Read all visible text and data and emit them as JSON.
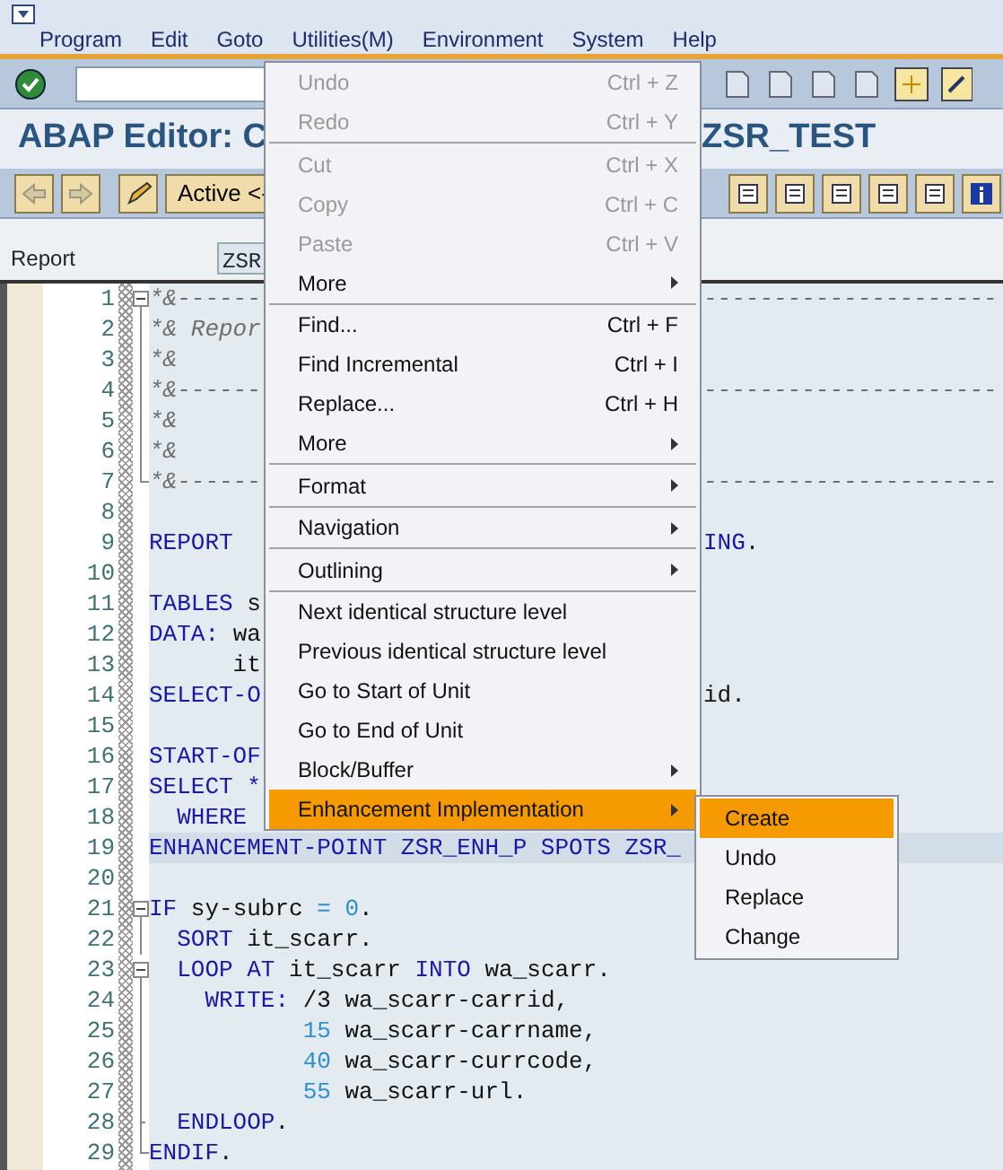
{
  "menubar": {
    "items": [
      {
        "label": "Program"
      },
      {
        "label": "Edit"
      },
      {
        "label": "Goto"
      },
      {
        "label": "Utilities(M)"
      },
      {
        "label": "Environment"
      },
      {
        "label": "System"
      },
      {
        "label": "Help"
      }
    ]
  },
  "title": {
    "left": "ABAP Editor: C",
    "right": "ZSR_TEST"
  },
  "app_toolbar": {
    "mode_button": "Active <-"
  },
  "program_row": {
    "label": "Report",
    "value": "ZSR"
  },
  "editor": {
    "lines": [
      {
        "number": "1",
        "kind": "fold_start",
        "current": false,
        "left": [
          {
            "kind": "comment",
            "text": "*&------"
          }
        ],
        "right": [
          {
            "kind": "comment",
            "text": "---------------------"
          }
        ]
      },
      {
        "number": "2",
        "kind": "fold_inner",
        "current": false,
        "left": [
          {
            "kind": "comment",
            "text": "*& Repor"
          }
        ]
      },
      {
        "number": "3",
        "kind": "fold_inner",
        "current": false,
        "left": [
          {
            "kind": "comment",
            "text": "*&"
          }
        ]
      },
      {
        "number": "4",
        "kind": "fold_inner",
        "current": false,
        "left": [
          {
            "kind": "comment",
            "text": "*&------"
          }
        ],
        "right": [
          {
            "kind": "comment",
            "text": "---------------------"
          }
        ]
      },
      {
        "number": "5",
        "kind": "fold_inner",
        "current": false,
        "left": [
          {
            "kind": "comment",
            "text": "*&"
          }
        ]
      },
      {
        "number": "6",
        "kind": "fold_inner",
        "current": false,
        "left": [
          {
            "kind": "comment",
            "text": "*&"
          }
        ]
      },
      {
        "number": "7",
        "kind": "fold_end",
        "current": false,
        "left": [
          {
            "kind": "comment",
            "text": "*&------"
          }
        ],
        "right": [
          {
            "kind": "comment",
            "text": "---------------------"
          }
        ]
      },
      {
        "number": "8",
        "kind": "plain",
        "current": false
      },
      {
        "number": "9",
        "kind": "plain",
        "current": false,
        "left": [
          {
            "kind": "kw",
            "text": "REPORT"
          }
        ],
        "right": [
          {
            "kind": "kw",
            "text": "ING"
          },
          {
            "kind": "text",
            "text": "."
          }
        ]
      },
      {
        "number": "10",
        "kind": "plain",
        "current": false
      },
      {
        "number": "11",
        "kind": "plain",
        "current": false,
        "left": [
          {
            "kind": "kw",
            "text": "TABLES"
          },
          {
            "kind": "text",
            "text": " s"
          }
        ]
      },
      {
        "number": "12",
        "kind": "plain",
        "current": false,
        "left": [
          {
            "kind": "kw",
            "text": "DATA:"
          },
          {
            "kind": "text",
            "text": " wa"
          }
        ]
      },
      {
        "number": "13",
        "kind": "plain",
        "current": false,
        "left": [
          {
            "kind": "text",
            "text": "      it"
          }
        ]
      },
      {
        "number": "14",
        "kind": "plain",
        "current": false,
        "left": [
          {
            "kind": "kw",
            "text": "SELECT-O"
          }
        ],
        "right": [
          {
            "kind": "text",
            "text": "id."
          }
        ]
      },
      {
        "number": "15",
        "kind": "plain",
        "current": false
      },
      {
        "number": "16",
        "kind": "plain",
        "current": false,
        "left": [
          {
            "kind": "kw",
            "text": "START-OF"
          }
        ]
      },
      {
        "number": "17",
        "kind": "plain",
        "current": false,
        "left": [
          {
            "kind": "kw",
            "text": "SELECT *"
          }
        ]
      },
      {
        "number": "18",
        "kind": "plain",
        "current": false,
        "left": [
          {
            "kind": "kw",
            "text": "  WHERE"
          }
        ]
      },
      {
        "number": "19",
        "kind": "plain",
        "current": true,
        "left": [
          {
            "kind": "kw",
            "text": "ENHANCEMENT-POINT ZSR_ENH_P SPOTS ZSR_"
          }
        ]
      },
      {
        "number": "20",
        "kind": "plain",
        "current": false
      },
      {
        "number": "21",
        "kind": "fold_start",
        "current": false,
        "left": [
          {
            "kind": "kw",
            "text": "IF"
          },
          {
            "kind": "text",
            "text": " sy-subrc "
          },
          {
            "kind": "num",
            "text": "= 0"
          },
          {
            "kind": "text",
            "text": "."
          }
        ]
      },
      {
        "number": "22",
        "kind": "fold_inner",
        "current": false,
        "left": [
          {
            "kind": "kw",
            "text": "  SORT"
          },
          {
            "kind": "text",
            "text": " it_scarr."
          }
        ]
      },
      {
        "number": "23",
        "kind": "fold_start",
        "current": false,
        "left": [
          {
            "kind": "kw",
            "text": "  LOOP AT"
          },
          {
            "kind": "text",
            "text": " it_scarr "
          },
          {
            "kind": "kw",
            "text": "INTO"
          },
          {
            "kind": "text",
            "text": " wa_scarr."
          }
        ]
      },
      {
        "number": "24",
        "kind": "fold_inner",
        "current": false,
        "left": [
          {
            "kind": "kw",
            "text": "    WRITE:"
          },
          {
            "kind": "text",
            "text": " /3 wa_scarr-carrid,"
          }
        ]
      },
      {
        "number": "25",
        "kind": "fold_inner",
        "current": false,
        "left": [
          {
            "kind": "num",
            "text": "           15"
          },
          {
            "kind": "text",
            "text": " wa_scarr-carrname,"
          }
        ]
      },
      {
        "number": "26",
        "kind": "fold_inner",
        "current": false,
        "left": [
          {
            "kind": "num",
            "text": "           40"
          },
          {
            "kind": "text",
            "text": " wa_scarr-currcode,"
          }
        ]
      },
      {
        "number": "27",
        "kind": "fold_inner",
        "current": false,
        "left": [
          {
            "kind": "num",
            "text": "           55"
          },
          {
            "kind": "text",
            "text": " wa_scarr-url."
          }
        ]
      },
      {
        "number": "28",
        "kind": "fold_tick",
        "current": false,
        "left": [
          {
            "kind": "kw",
            "text": "  ENDLOOP"
          },
          {
            "kind": "text",
            "text": "."
          }
        ]
      },
      {
        "number": "29",
        "kind": "fold_end",
        "current": false,
        "left": [
          {
            "kind": "kw",
            "text": "ENDIF"
          },
          {
            "kind": "text",
            "text": "."
          }
        ]
      }
    ]
  },
  "context_menu": {
    "items": [
      {
        "kind": "item",
        "label": "Undo",
        "shortcut": "Ctrl + Z",
        "disabled": true,
        "submenu": false,
        "selected": false
      },
      {
        "kind": "item",
        "label": "Redo",
        "shortcut": "Ctrl + Y",
        "disabled": true,
        "submenu": false,
        "selected": false
      },
      {
        "kind": "separator"
      },
      {
        "kind": "item",
        "label": "Cut",
        "shortcut": "Ctrl + X",
        "disabled": true,
        "submenu": false,
        "selected": false
      },
      {
        "kind": "item",
        "label": "Copy",
        "shortcut": "Ctrl + C",
        "disabled": true,
        "submenu": false,
        "selected": false
      },
      {
        "kind": "item",
        "label": "Paste",
        "shortcut": "Ctrl + V",
        "disabled": true,
        "submenu": false,
        "selected": false
      },
      {
        "kind": "item",
        "label": "More",
        "disabled": false,
        "submenu": true,
        "selected": false
      },
      {
        "kind": "separator"
      },
      {
        "kind": "item",
        "label": "Find...",
        "shortcut": "Ctrl + F",
        "disabled": false,
        "submenu": false,
        "selected": false
      },
      {
        "kind": "item",
        "label": "Find Incremental",
        "shortcut": "Ctrl + I",
        "disabled": false,
        "submenu": false,
        "selected": false
      },
      {
        "kind": "item",
        "label": "Replace...",
        "shortcut": "Ctrl + H",
        "disabled": false,
        "submenu": false,
        "selected": false
      },
      {
        "kind": "item",
        "label": "More",
        "disabled": false,
        "submenu": true,
        "selected": false
      },
      {
        "kind": "separator"
      },
      {
        "kind": "item",
        "label": "Format",
        "disabled": false,
        "submenu": true,
        "selected": false
      },
      {
        "kind": "separator"
      },
      {
        "kind": "item",
        "label": "Navigation",
        "disabled": false,
        "submenu": true,
        "selected": false
      },
      {
        "kind": "separator"
      },
      {
        "kind": "item",
        "label": "Outlining",
        "disabled": false,
        "submenu": true,
        "selected": false
      },
      {
        "kind": "separator"
      },
      {
        "kind": "item",
        "label": "Next identical structure level",
        "disabled": false,
        "submenu": false,
        "selected": false
      },
      {
        "kind": "item",
        "label": "Previous identical structure level",
        "disabled": false,
        "submenu": false,
        "selected": false
      },
      {
        "kind": "item",
        "label": "Go to Start of Unit",
        "disabled": false,
        "submenu": false,
        "selected": false
      },
      {
        "kind": "item",
        "label": "Go to End of Unit",
        "disabled": false,
        "submenu": false,
        "selected": false
      },
      {
        "kind": "item",
        "label": "Block/Buffer",
        "disabled": false,
        "submenu": true,
        "selected": false
      },
      {
        "kind": "item",
        "label": "Enhancement Implementation",
        "disabled": false,
        "submenu": true,
        "selected": true
      }
    ]
  },
  "submenu": {
    "items": [
      {
        "label": "Create",
        "selected": true
      },
      {
        "label": "Undo",
        "selected": false
      },
      {
        "label": "Replace",
        "selected": false
      },
      {
        "label": "Change",
        "selected": false
      }
    ]
  }
}
